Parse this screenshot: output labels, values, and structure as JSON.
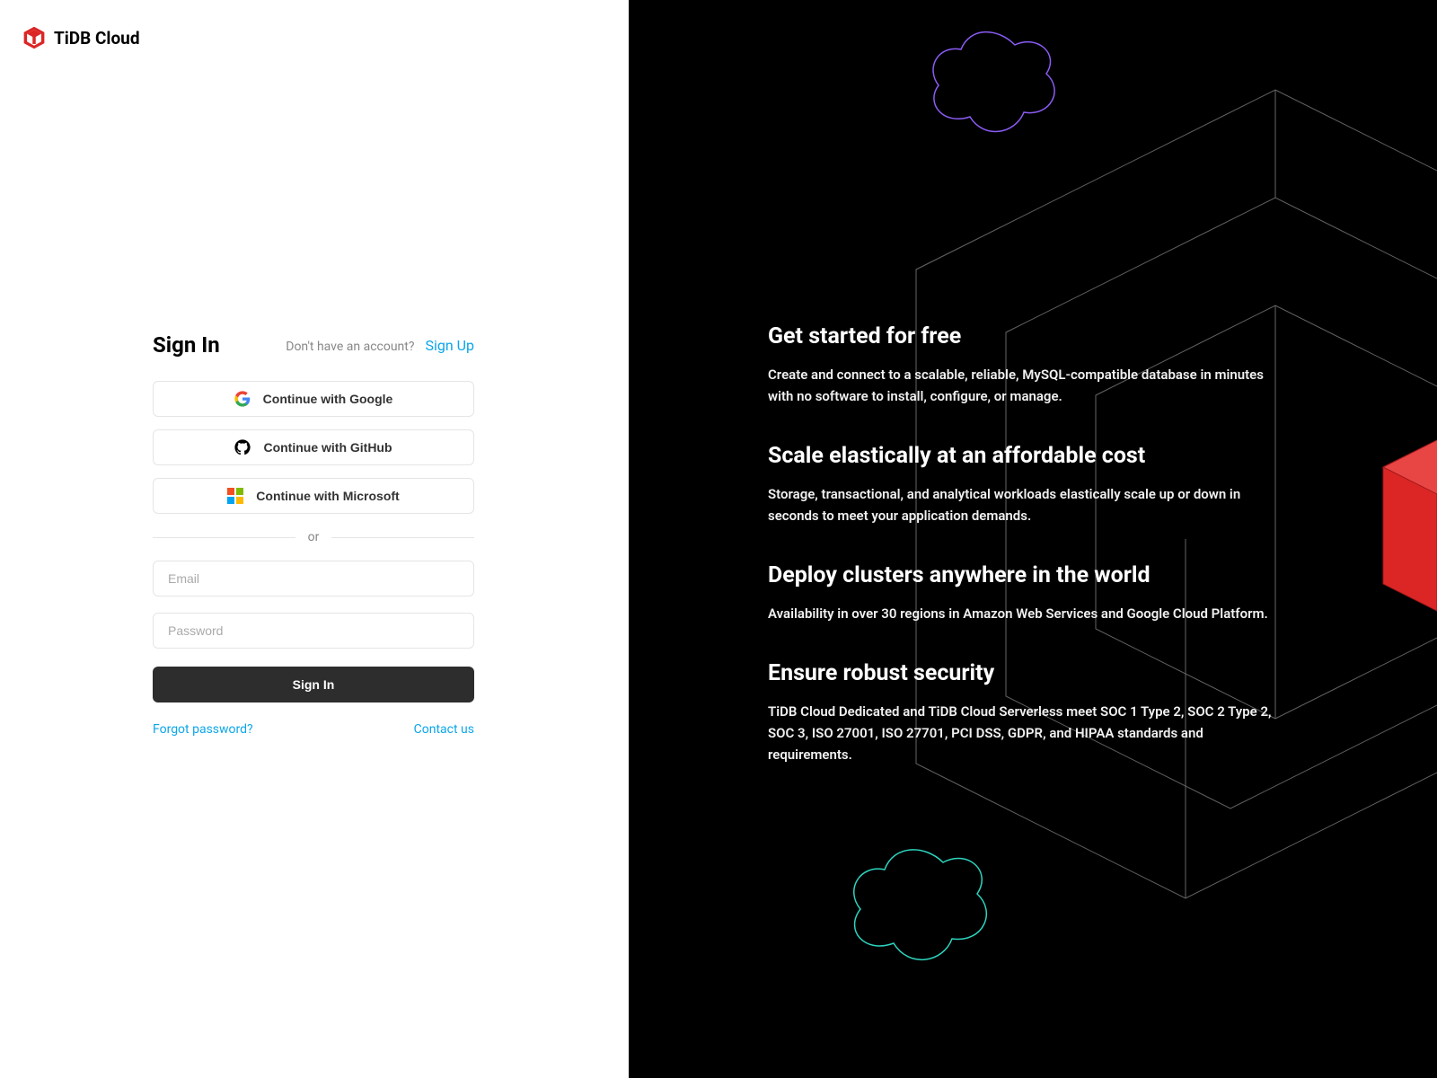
{
  "brand": "TiDB Cloud",
  "signin": {
    "title": "Sign In",
    "no_account": "Don't have an account?",
    "signup": "Sign Up",
    "google": "Continue with Google",
    "github": "Continue with GitHub",
    "microsoft": "Continue with Microsoft",
    "divider": "or",
    "email_placeholder": "Email",
    "password_placeholder": "Password",
    "submit": "Sign In",
    "forgot": "Forgot password?",
    "contact": "Contact us"
  },
  "features": [
    {
      "title": "Get started for free",
      "desc": "Create and connect to a scalable, reliable, MySQL-compatible database in minutes with no software to install, configure, or manage."
    },
    {
      "title": "Scale elastically at an affordable cost",
      "desc": "Storage, transactional, and analytical workloads elastically scale up or down in seconds to meet your application demands."
    },
    {
      "title": "Deploy clusters anywhere in the world",
      "desc": "Availability in over 30 regions in Amazon Web Services and Google Cloud Platform."
    },
    {
      "title": "Ensure robust security",
      "desc": "TiDB Cloud Dedicated and TiDB Cloud Serverless meet SOC 1 Type 2, SOC 2 Type 2, SOC 3, ISO 27001, ISO 27701, PCI DSS, GDPR, and HIPAA standards and requirements."
    }
  ]
}
